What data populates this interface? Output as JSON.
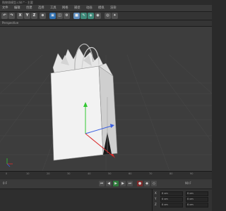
{
  "app": {
    "title": "购物袋模型.c4d * - 主要",
    "viewport_label": "Perspective"
  },
  "menubar": {
    "items": [
      "文件",
      "编辑",
      "创建",
      "选择",
      "工具",
      "网格",
      "捕捉",
      "动画",
      "模拟",
      "渲染"
    ]
  },
  "toolbar": {
    "undo_icon": "undo-icon",
    "redo_icon": "redo-icon",
    "x_label": "X",
    "y_label": "Y",
    "z_label": "Z",
    "cube_icon": "cube-icon",
    "pen_icon": "pen-icon",
    "subdivide_icon": "subdivide-icon",
    "light_icon": "light-icon"
  },
  "timeline": {
    "ticks": [
      "0",
      "10",
      "20",
      "30",
      "40",
      "50",
      "60",
      "70",
      "80",
      "90"
    ]
  },
  "transport": {
    "frame_start": "0 F",
    "frame_end": "90 F"
  },
  "attributes": {
    "rows": [
      {
        "axis": "X",
        "value": "0 cm",
        "value2": "0 cm"
      },
      {
        "axis": "Y",
        "value": "0 cm",
        "value2": "0 cm"
      },
      {
        "axis": "Z",
        "value": "0 cm",
        "value2": "0 cm"
      }
    ]
  },
  "colors": {
    "axis_x": "#d92b2b",
    "axis_y": "#32c832",
    "axis_z": "#3a5fe0",
    "viewport_bg": "#3d3d3d"
  }
}
